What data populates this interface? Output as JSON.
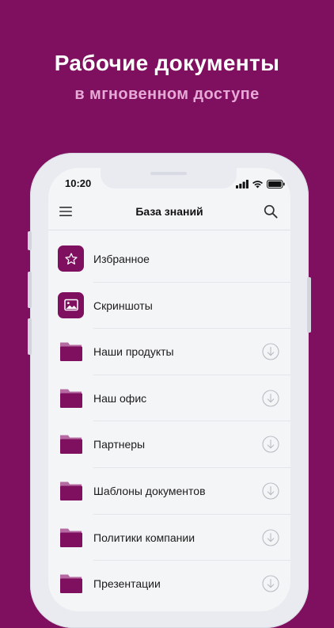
{
  "promo": {
    "headline": "Рабочие документы",
    "subline": "в мгновенном доступе"
  },
  "status_bar": {
    "time": "10:20",
    "icons": [
      "signal-icon",
      "wifi-icon",
      "battery-icon"
    ]
  },
  "navbar": {
    "title": "База знаний",
    "left_icon": "hamburger-menu-icon",
    "right_icon": "search-icon"
  },
  "list": {
    "items": [
      {
        "label": "Избранное",
        "icon": "star-icon",
        "downloadable": false
      },
      {
        "label": "Скриншоты",
        "icon": "image-icon",
        "downloadable": false
      },
      {
        "label": "Наши продукты",
        "icon": "folder-icon",
        "downloadable": true
      },
      {
        "label": "Наш офис",
        "icon": "folder-icon",
        "downloadable": true
      },
      {
        "label": "Партнеры",
        "icon": "folder-icon",
        "downloadable": true
      },
      {
        "label": "Шаблоны документов",
        "icon": "folder-icon",
        "downloadable": true
      },
      {
        "label": "Политики компании",
        "icon": "folder-icon",
        "downloadable": true
      },
      {
        "label": "Презентации",
        "icon": "folder-icon",
        "downloadable": true
      }
    ]
  },
  "colors": {
    "brand": "#7f0f5f",
    "subline": "#e7a9d6",
    "folder_tab": "#b56aa2",
    "screen_bg": "#f4f5f7"
  }
}
